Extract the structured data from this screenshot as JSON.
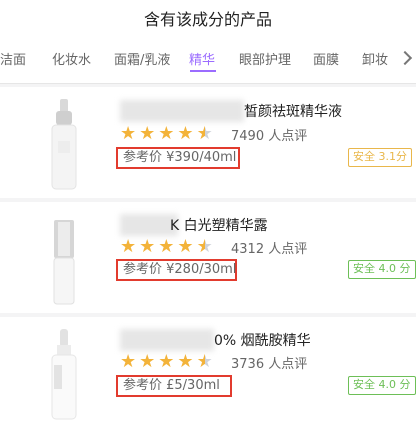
{
  "header": {
    "title": "含有该成分的产品"
  },
  "tabs": [
    {
      "label": "洁面"
    },
    {
      "label": "化妆水"
    },
    {
      "label": "面霜/乳液"
    },
    {
      "label": "精华",
      "active": true
    },
    {
      "label": "眼部护理"
    },
    {
      "label": "面膜"
    },
    {
      "label": "卸妆"
    }
  ],
  "colors": {
    "accent": "#9b6cff",
    "star": "#f3b33a",
    "highlight_box": "#e23b2e",
    "safe_green": "#6dbf57",
    "safe_amber": "#e9b74b"
  },
  "products": [
    {
      "name": "皙颜祛斑精华液",
      "rating": 4.5,
      "reviews": "7490 人点评",
      "price": "参考价 ¥390/40ml",
      "safety": "安全 3.1分",
      "safety_color": "#e9b74b"
    },
    {
      "name": "K    白光塑精华露",
      "rating": 4.5,
      "reviews": "4312 人点评",
      "price": "参考价 ¥280/30ml",
      "safety": "安全 4.0 分",
      "safety_color": "#6dbf57"
    },
    {
      "name": "0% 烟酰胺精华",
      "rating": 4.5,
      "reviews": "3736 人点评",
      "price": "参考价 £5/30ml",
      "safety": "安全 4.0 分",
      "safety_color": "#6dbf57"
    }
  ]
}
